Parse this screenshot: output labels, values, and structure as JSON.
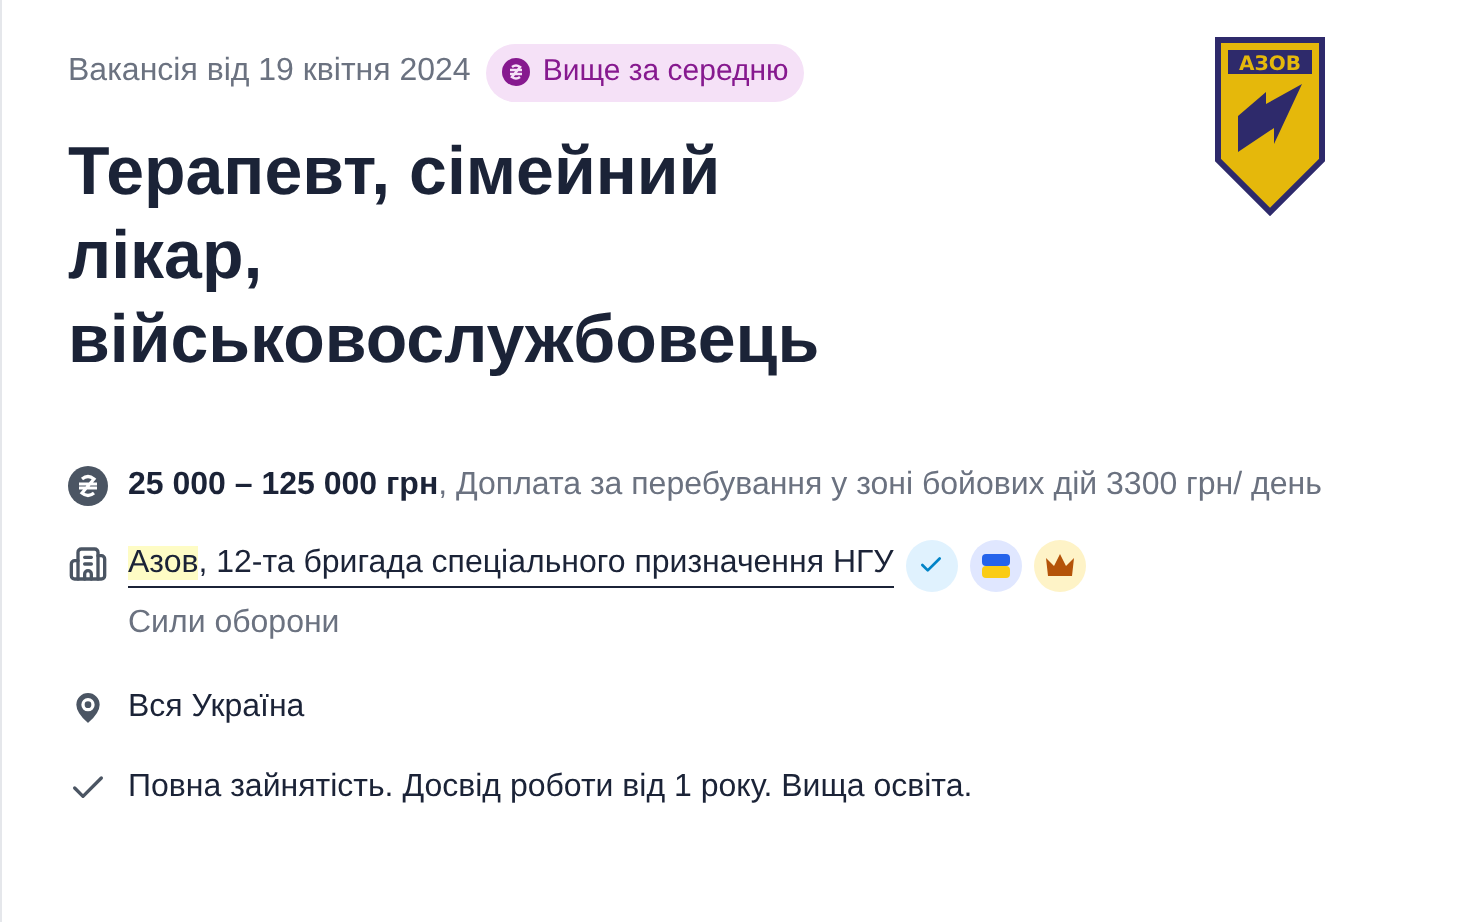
{
  "posted": "Вакансія від 19 квітня 2024",
  "badge": {
    "label": "Вище за середню"
  },
  "logo": {
    "text": "АЗОВ"
  },
  "title": "Терапевт, сімейний лікар, військовослужбовець",
  "salary": "**25 000 – 125 000 грн**, Доплата за перебування у зоні бойових дій 3300 грн/ день",
  "company": {
    "name": "Азов",
    "rest": ", 12-та бригада спеціального призначення НГУ",
    "highlighted": true,
    "category": "Сили оборони"
  },
  "company_badges": [
    {
      "kind": "verified"
    },
    {
      "kind": "flag"
    },
    {
      "kind": "crown"
    }
  ],
  "location": "Вся Україна",
  "details": "Повна зайнятість. Досвід роботи від 1 року. Вища освіта."
}
